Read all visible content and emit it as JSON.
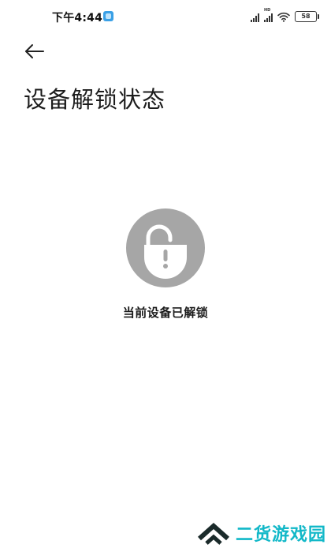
{
  "status_bar": {
    "time": "下午4:44",
    "battery": "58"
  },
  "header": {
    "title": "设备解锁状态"
  },
  "main": {
    "status_icon": "unlocked-padlock-warning-icon",
    "status_message": "当前设备已解锁"
  },
  "watermark": {
    "text": "二货游戏园"
  },
  "colors": {
    "background": "#ffffff",
    "icon_circle": "#a6a6a6",
    "watermark": "#12b8c8"
  }
}
